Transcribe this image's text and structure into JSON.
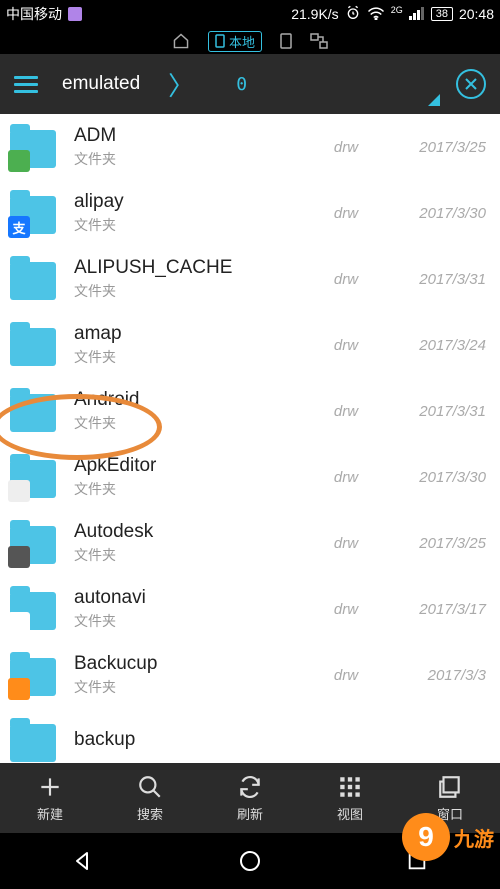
{
  "status": {
    "carrier": "中国移动",
    "speed": "21.9K/s",
    "net_label": "2G",
    "battery": "38",
    "time": "20:48"
  },
  "substatus": {
    "local_label": "本地"
  },
  "header": {
    "path": "emulated",
    "count": "0"
  },
  "folders": [
    {
      "name": "ADM",
      "sub": "文件夹",
      "perm": "drw",
      "date": "2017/3/25",
      "overlay": "ov-adm",
      "ovtext": ""
    },
    {
      "name": "alipay",
      "sub": "文件夹",
      "perm": "drw",
      "date": "2017/3/30",
      "overlay": "ov-alipay",
      "ovtext": "支"
    },
    {
      "name": "ALIPUSH_CACHE",
      "sub": "文件夹",
      "perm": "drw",
      "date": "2017/3/31",
      "overlay": "",
      "ovtext": ""
    },
    {
      "name": "amap",
      "sub": "文件夹",
      "perm": "drw",
      "date": "2017/3/24",
      "overlay": "",
      "ovtext": ""
    },
    {
      "name": "Android",
      "sub": "文件夹",
      "perm": "drw",
      "date": "2017/3/31",
      "overlay": "",
      "ovtext": ""
    },
    {
      "name": "ApkEditor",
      "sub": "文件夹",
      "perm": "drw",
      "date": "2017/3/30",
      "overlay": "ov-apk",
      "ovtext": ""
    },
    {
      "name": "Autodesk",
      "sub": "文件夹",
      "perm": "drw",
      "date": "2017/3/25",
      "overlay": "ov-autodesk",
      "ovtext": ""
    },
    {
      "name": "autonavi",
      "sub": "文件夹",
      "perm": "drw",
      "date": "2017/3/17",
      "overlay": "ov-autonavi",
      "ovtext": ""
    },
    {
      "name": "Backucup",
      "sub": "文件夹",
      "perm": "drw",
      "date": "2017/3/3",
      "overlay": "ov-backucup",
      "ovtext": ""
    },
    {
      "name": "backup",
      "sub": "",
      "perm": "",
      "date": "",
      "overlay": "",
      "ovtext": ""
    }
  ],
  "toolbar": {
    "new": "新建",
    "search": "搜索",
    "refresh": "刷新",
    "view": "视图",
    "window": "窗口"
  },
  "watermark": {
    "nine": "9",
    "text": "九游"
  }
}
